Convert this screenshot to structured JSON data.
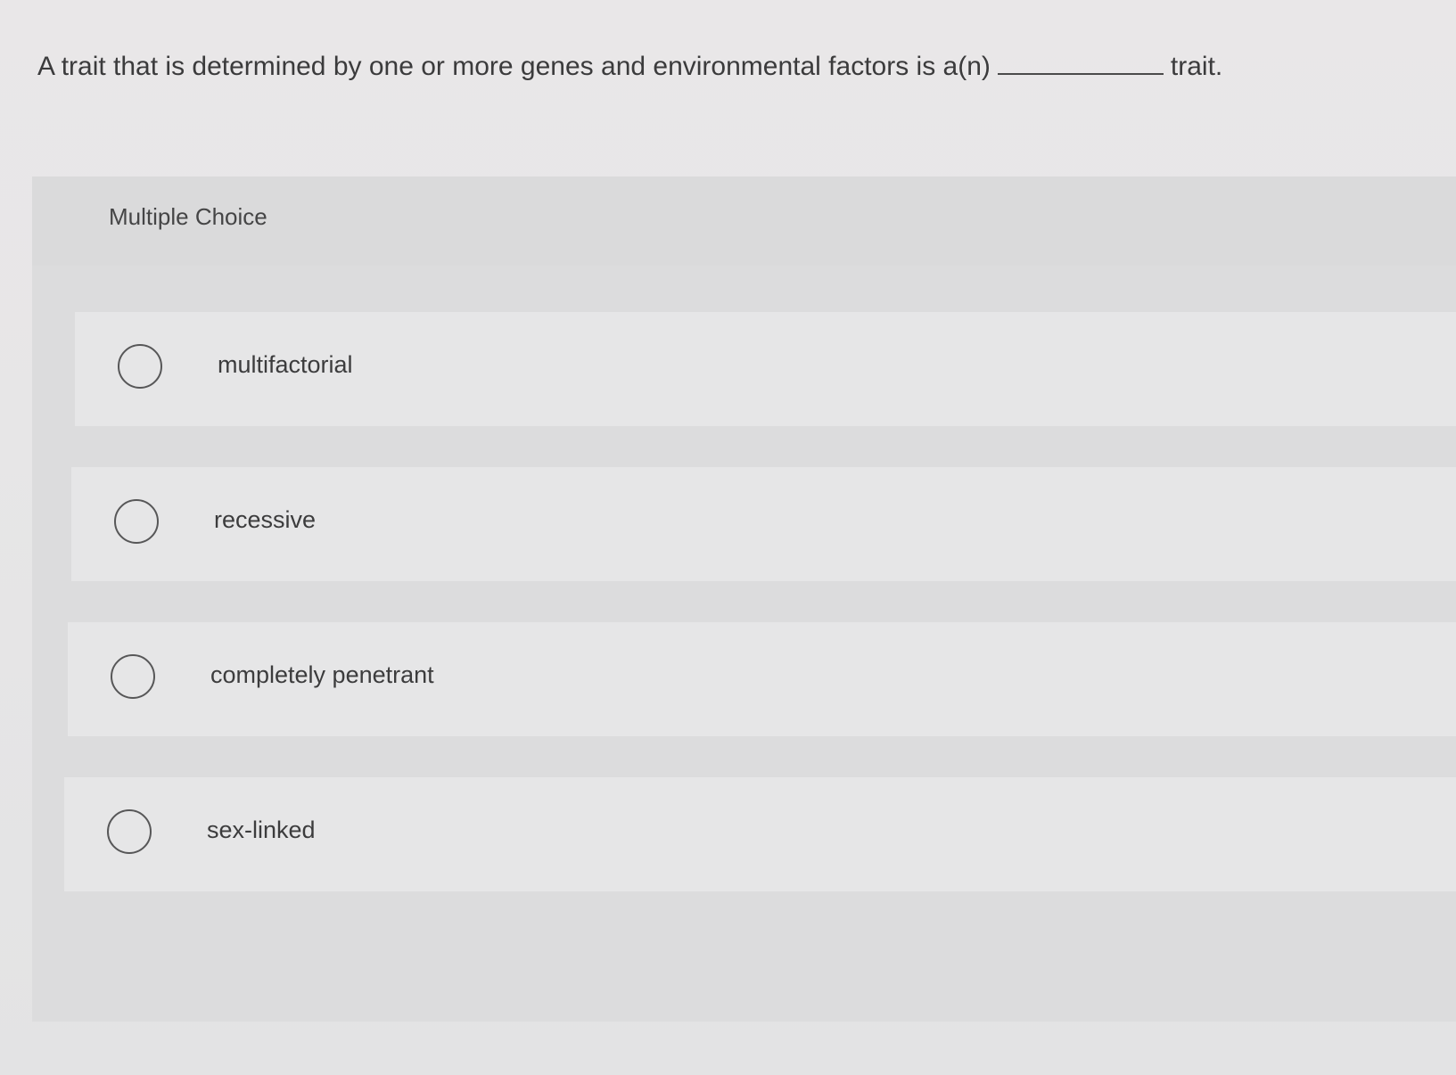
{
  "question": {
    "prefix": "A trait that is determined by one or more genes and environmental factors is a(n)",
    "suffix": "trait."
  },
  "panel": {
    "title": "Multiple Choice"
  },
  "options": [
    {
      "label": "multifactorial",
      "selected": false
    },
    {
      "label": "recessive",
      "selected": false
    },
    {
      "label": "completely penetrant",
      "selected": false
    },
    {
      "label": "sex-linked",
      "selected": false
    }
  ]
}
